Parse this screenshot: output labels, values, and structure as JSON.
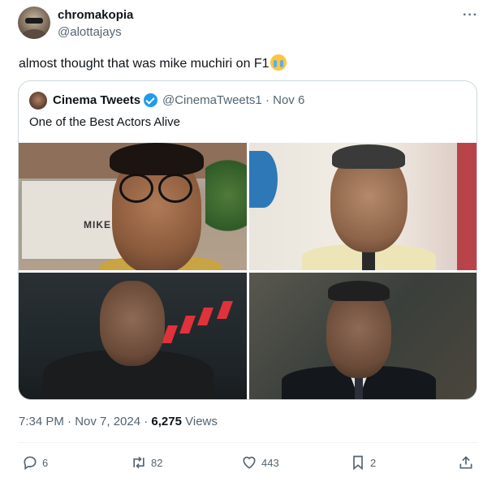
{
  "author": {
    "name": "chromakopia",
    "handle": "@alottajays"
  },
  "more_label": "···",
  "tweet": {
    "text": "almost thought that was mike muchiri on F1"
  },
  "quoted": {
    "name": "Cinema Tweets",
    "handle_date": "@CinemaTweets1 · Nov 6",
    "text": "One of the Best Actors Alive",
    "sign_text": "MIKE"
  },
  "meta": {
    "timestamp": "7:34 PM · Nov 7, 2024 · ",
    "views_count": "6,275",
    "views_label": " Views"
  },
  "actions": {
    "replies": "6",
    "retweets": "82",
    "likes": "443",
    "bookmarks": "2"
  },
  "icons": {
    "verified": "verified-badge-icon",
    "emoji": "loudly-crying-face-emoji"
  },
  "colors": {
    "accent": "#1d9bf0",
    "secondary_text": "#536471",
    "border": "#cfd9de"
  }
}
